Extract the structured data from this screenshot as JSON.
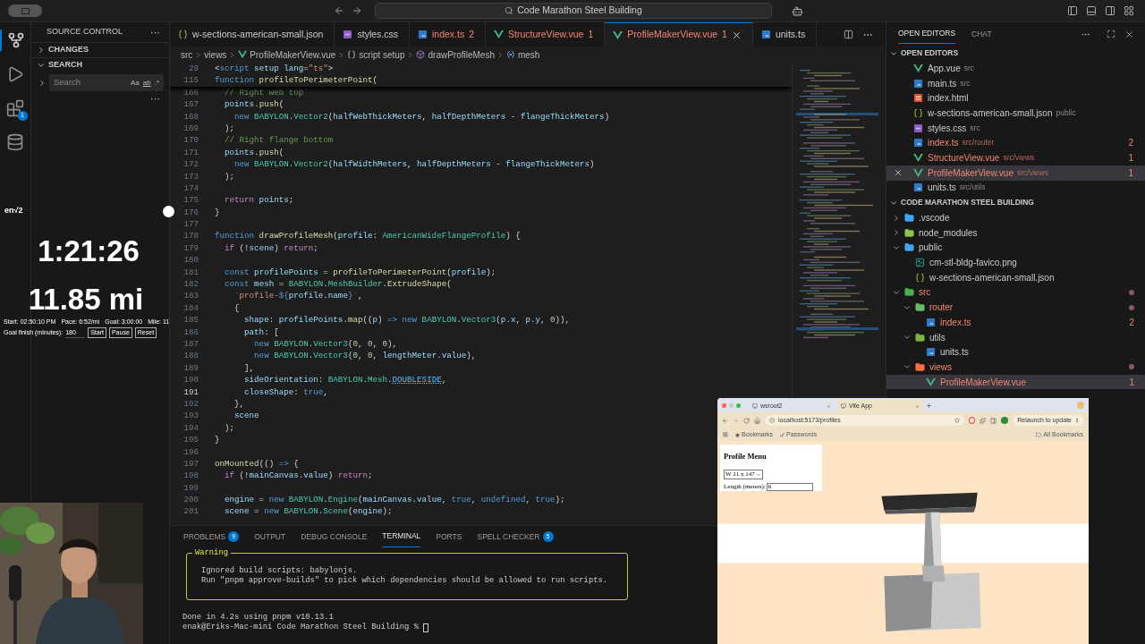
{
  "titlebar": {
    "search": "Code Marathon Steel Building"
  },
  "activity": [
    {
      "kind": "source-control",
      "selected": true
    },
    {
      "kind": "run",
      "selected": false
    },
    {
      "kind": "extensions",
      "selected": false,
      "badge": "1"
    },
    {
      "kind": "database",
      "selected": false
    }
  ],
  "sidebar": {
    "title": "SOURCE CONTROL",
    "more": "···",
    "sections": [
      {
        "label": "CHANGES",
        "expanded": false
      },
      {
        "label": "SEARCH",
        "expanded": true
      }
    ],
    "search": {
      "placeholder": "Search",
      "options": [
        "Aa",
        "ab",
        ".*"
      ]
    },
    "search_more": "···"
  },
  "overlay": {
    "logo": "en√2",
    "time": "1:21:26",
    "distance": "11.85 mi",
    "stats": [
      "Start: 02:50:10 PM",
      "Pace: 6:52/mi",
      "Goal: 3:00:00",
      "Mile: 11"
    ],
    "goal_label": "Goal finish (minutes):",
    "goal_value": "180",
    "buttons": [
      "Start",
      "Pause",
      "Reset"
    ]
  },
  "tabs": [
    {
      "label": "w-sections-american-small.json",
      "kind": "json",
      "selected": false,
      "problem": false
    },
    {
      "label": "styles.css",
      "kind": "css",
      "selected": false,
      "problem": false
    },
    {
      "label": "index.ts",
      "kind": "ts",
      "selected": false,
      "problem": true,
      "badge": "2"
    },
    {
      "label": "StructureView.vue",
      "kind": "vue",
      "selected": false,
      "problem": true,
      "badge": "1"
    },
    {
      "label": "ProfileMakerView.vue",
      "kind": "vue",
      "selected": true,
      "problem": true,
      "badge": "1"
    },
    {
      "label": "units.ts",
      "kind": "ts",
      "selected": false,
      "problem": false
    }
  ],
  "breadcrumbs": [
    {
      "label": "src",
      "kind": "text"
    },
    {
      "label": "views",
      "kind": "text"
    },
    {
      "label": "ProfileMakerView.vue",
      "kind": "vue"
    },
    {
      "label": "script setup",
      "kind": "braces"
    },
    {
      "label": "drawProfileMesh",
      "kind": "method"
    },
    {
      "label": "mesh",
      "kind": "variable"
    }
  ],
  "editor": {
    "sticky": [
      {
        "n": "29",
        "segs": [
          {
            "text": "<",
            "kind": "plain"
          },
          {
            "text": "script",
            "kind": "keyword"
          },
          {
            "text": " setup",
            "kind": "variable"
          },
          {
            "text": " lang",
            "kind": "variable"
          },
          {
            "text": "=",
            "kind": "plain"
          },
          {
            "text": "\"ts\"",
            "kind": "string"
          },
          {
            "text": ">",
            "kind": "plain"
          }
        ]
      },
      {
        "n": "115",
        "segs": [
          {
            "text": "function",
            "kind": "keyword"
          },
          {
            "text": " profileToPerimeterPoint",
            "kind": "function"
          },
          {
            "text": "(",
            "kind": "plain"
          }
        ]
      }
    ],
    "lines": [
      {
        "n": "166",
        "current": false,
        "segs": [
          {
            "text": "  // Right web top",
            "kind": "comment"
          }
        ]
      },
      {
        "n": "167",
        "current": false,
        "segs": [
          {
            "text": "  points",
            "kind": "variable"
          },
          {
            "text": ".",
            "kind": "plain"
          },
          {
            "text": "push",
            "kind": "function"
          },
          {
            "text": "(",
            "kind": "plain"
          }
        ]
      },
      {
        "n": "168",
        "current": false,
        "segs": [
          {
            "text": "    new",
            "kind": "keyword"
          },
          {
            "text": " BABYLON",
            "kind": "type"
          },
          {
            "text": ".",
            "kind": "plain"
          },
          {
            "text": "Vector2",
            "kind": "type"
          },
          {
            "text": "(",
            "kind": "plain"
          },
          {
            "text": "halfWebThickMeters",
            "kind": "variable"
          },
          {
            "text": ", ",
            "kind": "plain"
          },
          {
            "text": "halfDepthMeters",
            "kind": "variable"
          },
          {
            "text": " - ",
            "kind": "plain"
          },
          {
            "text": "flangeThickMeters",
            "kind": "variable"
          },
          {
            "text": ")",
            "kind": "plain"
          }
        ]
      },
      {
        "n": "169",
        "current": false,
        "segs": [
          {
            "text": "  );",
            "kind": "plain"
          }
        ]
      },
      {
        "n": "170",
        "current": false,
        "segs": [
          {
            "text": "  // Right flange bottom",
            "kind": "comment"
          }
        ]
      },
      {
        "n": "171",
        "current": false,
        "segs": [
          {
            "text": "  points",
            "kind": "variable"
          },
          {
            "text": ".",
            "kind": "plain"
          },
          {
            "text": "push",
            "kind": "function"
          },
          {
            "text": "(",
            "kind": "plain"
          }
        ]
      },
      {
        "n": "172",
        "current": false,
        "segs": [
          {
            "text": "    new",
            "kind": "keyword"
          },
          {
            "text": " BABYLON",
            "kind": "type"
          },
          {
            "text": ".",
            "kind": "plain"
          },
          {
            "text": "Vector2",
            "kind": "type"
          },
          {
            "text": "(",
            "kind": "plain"
          },
          {
            "text": "halfWidthMeters",
            "kind": "variable"
          },
          {
            "text": ", ",
            "kind": "plain"
          },
          {
            "text": "halfDepthMeters",
            "kind": "variable"
          },
          {
            "text": " - ",
            "kind": "plain"
          },
          {
            "text": "flangeThickMeters",
            "kind": "variable"
          },
          {
            "text": ")",
            "kind": "plain"
          }
        ]
      },
      {
        "n": "173",
        "current": false,
        "segs": [
          {
            "text": "  );",
            "kind": "plain"
          }
        ]
      },
      {
        "n": "174",
        "current": false
      },
      {
        "n": "175",
        "current": false,
        "segs": [
          {
            "text": "  return",
            "kind": "control"
          },
          {
            "text": " points",
            "kind": "variable"
          },
          {
            "text": ";",
            "kind": "plain"
          }
        ]
      },
      {
        "n": "176",
        "current": false,
        "segs": [
          {
            "text": "}",
            "kind": "plain"
          }
        ]
      },
      {
        "n": "177",
        "current": false
      },
      {
        "n": "178",
        "current": false,
        "segs": [
          {
            "text": "function",
            "kind": "keyword"
          },
          {
            "text": " drawProfileMesh",
            "kind": "function"
          },
          {
            "text": "(",
            "kind": "plain"
          },
          {
            "text": "profile",
            "kind": "variable"
          },
          {
            "text": ": ",
            "kind": "plain"
          },
          {
            "text": "AmericanWideFlangeProfile",
            "kind": "type"
          },
          {
            "text": ") {",
            "kind": "plain"
          }
        ]
      },
      {
        "n": "179",
        "current": false,
        "segs": [
          {
            "text": "  if",
            "kind": "control"
          },
          {
            "text": " (!",
            "kind": "plain"
          },
          {
            "text": "scene",
            "kind": "variable"
          },
          {
            "text": ") ",
            "kind": "plain"
          },
          {
            "text": "return",
            "kind": "control"
          },
          {
            "text": ";",
            "kind": "plain"
          }
        ]
      },
      {
        "n": "180",
        "current": false
      },
      {
        "n": "181",
        "current": false,
        "segs": [
          {
            "text": "  const",
            "kind": "keyword"
          },
          {
            "text": " profilePoints",
            "kind": "variable"
          },
          {
            "text": " = ",
            "kind": "plain"
          },
          {
            "text": "profileToPerimeterPoint",
            "kind": "function"
          },
          {
            "text": "(",
            "kind": "plain"
          },
          {
            "text": "profile",
            "kind": "variable"
          },
          {
            "text": ");",
            "kind": "plain"
          }
        ]
      },
      {
        "n": "182",
        "current": false,
        "segs": [
          {
            "text": "  const",
            "kind": "keyword"
          },
          {
            "text": " mesh",
            "kind": "variable"
          },
          {
            "text": " = ",
            "kind": "plain"
          },
          {
            "text": "BABYLON",
            "kind": "type"
          },
          {
            "text": ".",
            "kind": "plain"
          },
          {
            "text": "MeshBuilder",
            "kind": "type"
          },
          {
            "text": ".",
            "kind": "plain"
          },
          {
            "text": "ExtrudeShape",
            "kind": "function"
          },
          {
            "text": "(",
            "kind": "plain"
          }
        ]
      },
      {
        "n": "183",
        "current": false,
        "segs": [
          {
            "text": "    `profile-",
            "kind": "string"
          },
          {
            "text": "${",
            "kind": "keyword"
          },
          {
            "text": "profile",
            "kind": "variable"
          },
          {
            "text": ".",
            "kind": "plain"
          },
          {
            "text": "name",
            "kind": "variable"
          },
          {
            "text": "}",
            "kind": "keyword"
          },
          {
            "text": "`",
            "kind": "string"
          },
          {
            "text": ",",
            "kind": "plain"
          }
        ]
      },
      {
        "n": "184",
        "current": false,
        "segs": [
          {
            "text": "    {",
            "kind": "plain"
          }
        ]
      },
      {
        "n": "185",
        "current": false,
        "segs": [
          {
            "text": "      shape",
            "kind": "variable"
          },
          {
            "text": ": ",
            "kind": "plain"
          },
          {
            "text": "profilePoints",
            "kind": "variable"
          },
          {
            "text": ".",
            "kind": "plain"
          },
          {
            "text": "map",
            "kind": "function"
          },
          {
            "text": "((",
            "kind": "plain"
          },
          {
            "text": "p",
            "kind": "variable"
          },
          {
            "text": ") ",
            "kind": "plain"
          },
          {
            "text": "=>",
            "kind": "keyword"
          },
          {
            "text": " new",
            "kind": "keyword"
          },
          {
            "text": " BABYLON",
            "kind": "type"
          },
          {
            "text": ".",
            "kind": "plain"
          },
          {
            "text": "Vector3",
            "kind": "type"
          },
          {
            "text": "(",
            "kind": "plain"
          },
          {
            "text": "p",
            "kind": "variable"
          },
          {
            "text": ".",
            "kind": "plain"
          },
          {
            "text": "x",
            "kind": "variable"
          },
          {
            "text": ", ",
            "kind": "plain"
          },
          {
            "text": "p",
            "kind": "variable"
          },
          {
            "text": ".",
            "kind": "plain"
          },
          {
            "text": "y",
            "kind": "variable"
          },
          {
            "text": ", ",
            "kind": "plain"
          },
          {
            "text": "0",
            "kind": "number"
          },
          {
            "text": ")),",
            "kind": "plain"
          }
        ]
      },
      {
        "n": "186",
        "current": false,
        "segs": [
          {
            "text": "      path",
            "kind": "variable"
          },
          {
            "text": ": [",
            "kind": "plain"
          }
        ]
      },
      {
        "n": "187",
        "current": false,
        "segs": [
          {
            "text": "        new",
            "kind": "keyword"
          },
          {
            "text": " BABYLON",
            "kind": "type"
          },
          {
            "text": ".",
            "kind": "plain"
          },
          {
            "text": "Vector3",
            "kind": "type"
          },
          {
            "text": "(",
            "kind": "plain"
          },
          {
            "text": "0",
            "kind": "number"
          },
          {
            "text": ", ",
            "kind": "plain"
          },
          {
            "text": "0",
            "kind": "number"
          },
          {
            "text": ", ",
            "kind": "plain"
          },
          {
            "text": "0",
            "kind": "number"
          },
          {
            "text": "),",
            "kind": "plain"
          }
        ]
      },
      {
        "n": "188",
        "current": false,
        "segs": [
          {
            "text": "        new",
            "kind": "keyword"
          },
          {
            "text": " BABYLON",
            "kind": "type"
          },
          {
            "text": ".",
            "kind": "plain"
          },
          {
            "text": "Vector3",
            "kind": "type"
          },
          {
            "text": "(",
            "kind": "plain"
          },
          {
            "text": "0",
            "kind": "number"
          },
          {
            "text": ", ",
            "kind": "plain"
          },
          {
            "text": "0",
            "kind": "number"
          },
          {
            "text": ", ",
            "kind": "plain"
          },
          {
            "text": "lengthMeter",
            "kind": "variable"
          },
          {
            "text": ".",
            "kind": "plain"
          },
          {
            "text": "value",
            "kind": "variable"
          },
          {
            "text": "),",
            "kind": "plain"
          }
        ]
      },
      {
        "n": "189",
        "current": false,
        "segs": [
          {
            "text": "      ],",
            "kind": "plain"
          }
        ]
      },
      {
        "n": "190",
        "current": false,
        "segs": [
          {
            "text": "      sideOrientation",
            "kind": "variable"
          },
          {
            "text": ": ",
            "kind": "plain"
          },
          {
            "text": "BABYLON",
            "kind": "type"
          },
          {
            "text": ".",
            "kind": "plain"
          },
          {
            "text": "Mesh",
            "kind": "type"
          },
          {
            "text": ".",
            "kind": "plain"
          },
          {
            "text": "DOUBLESIDE",
            "kind": "constant"
          },
          {
            "text": ",",
            "kind": "plain"
          }
        ]
      },
      {
        "n": "191",
        "current": true,
        "segs": [
          {
            "text": "      closeShape",
            "kind": "variable"
          },
          {
            "text": ": ",
            "kind": "plain"
          },
          {
            "text": "true",
            "kind": "keyword"
          },
          {
            "text": ",",
            "kind": "plain"
          }
        ]
      },
      {
        "n": "192",
        "current": false,
        "segs": [
          {
            "text": "    },",
            "kind": "plain"
          }
        ]
      },
      {
        "n": "193",
        "current": false,
        "segs": [
          {
            "text": "    scene",
            "kind": "variable"
          }
        ]
      },
      {
        "n": "194",
        "current": false,
        "segs": [
          {
            "text": "  );",
            "kind": "plain"
          }
        ]
      },
      {
        "n": "195",
        "current": false,
        "segs": [
          {
            "text": "}",
            "kind": "plain"
          }
        ]
      },
      {
        "n": "196",
        "current": false
      },
      {
        "n": "197",
        "current": false,
        "segs": [
          {
            "text": "onMounted",
            "kind": "function"
          },
          {
            "text": "(() ",
            "kind": "plain"
          },
          {
            "text": "=>",
            "kind": "keyword"
          },
          {
            "text": " {",
            "kind": "plain"
          }
        ]
      },
      {
        "n": "198",
        "current": false,
        "segs": [
          {
            "text": "  if",
            "kind": "control"
          },
          {
            "text": " (!",
            "kind": "plain"
          },
          {
            "text": "mainCanvas",
            "kind": "variable"
          },
          {
            "text": ".",
            "kind": "plain"
          },
          {
            "text": "value",
            "kind": "variable"
          },
          {
            "text": ") ",
            "kind": "plain"
          },
          {
            "text": "return",
            "kind": "control"
          },
          {
            "text": ";",
            "kind": "plain"
          }
        ]
      },
      {
        "n": "199",
        "current": false
      },
      {
        "n": "200",
        "current": false,
        "segs": [
          {
            "text": "  engine",
            "kind": "variable"
          },
          {
            "text": " = ",
            "kind": "plain"
          },
          {
            "text": "new",
            "kind": "keyword"
          },
          {
            "text": " BABYLON",
            "kind": "type"
          },
          {
            "text": ".",
            "kind": "plain"
          },
          {
            "text": "Engine",
            "kind": "type"
          },
          {
            "text": "(",
            "kind": "plain"
          },
          {
            "text": "mainCanvas",
            "kind": "variable"
          },
          {
            "text": ".",
            "kind": "plain"
          },
          {
            "text": "value",
            "kind": "variable"
          },
          {
            "text": ", ",
            "kind": "plain"
          },
          {
            "text": "true",
            "kind": "keyword"
          },
          {
            "text": ", ",
            "kind": "plain"
          },
          {
            "text": "undefined",
            "kind": "keyword"
          },
          {
            "text": ", ",
            "kind": "plain"
          },
          {
            "text": "true",
            "kind": "keyword"
          },
          {
            "text": ");",
            "kind": "plain"
          }
        ]
      },
      {
        "n": "201",
        "current": false,
        "segs": [
          {
            "text": "  scene",
            "kind": "variable"
          },
          {
            "text": " = ",
            "kind": "plain"
          },
          {
            "text": "new",
            "kind": "keyword"
          },
          {
            "text": " BABYLON",
            "kind": "type"
          },
          {
            "text": ".",
            "kind": "plain"
          },
          {
            "text": "Scene",
            "kind": "type"
          },
          {
            "text": "(",
            "kind": "plain"
          },
          {
            "text": "engine",
            "kind": "variable"
          },
          {
            "text": ");",
            "kind": "plain"
          }
        ]
      }
    ]
  },
  "panel": {
    "tabs": [
      {
        "label": "PROBLEMS",
        "selected": false,
        "badge": "9"
      },
      {
        "label": "OUTPUT",
        "selected": false
      },
      {
        "label": "DEBUG CONSOLE",
        "selected": false
      },
      {
        "label": "TERMINAL",
        "selected": true
      },
      {
        "label": "PORTS",
        "selected": false
      },
      {
        "label": "SPELL CHECKER",
        "selected": false,
        "badge": "5"
      }
    ],
    "warning": {
      "title": "Warning",
      "lines": [
        "Ignored build scripts: babylonjs.",
        "Run \"pnpm approve-builds\" to pick which dependencies should be allowed to run scripts."
      ]
    },
    "output": "Done in 4.2s using pnpm v10.13.1",
    "prompt": "enak@Eriks-Mac-mini Code Marathon Steel Building %"
  },
  "right": {
    "tabs": [
      {
        "label": "OPEN EDITORS",
        "selected": true
      },
      {
        "label": "CHAT",
        "selected": false
      }
    ],
    "open_editors": {
      "title": "OPEN EDITORS",
      "expanded": true,
      "items": [
        {
          "name": "App.vue",
          "path": "src",
          "kind": "vue",
          "selected": false,
          "problem": false
        },
        {
          "name": "main.ts",
          "path": "src",
          "kind": "ts",
          "selected": false,
          "problem": false
        },
        {
          "name": "index.html",
          "kind": "html",
          "selected": false,
          "problem": false
        },
        {
          "name": "w-sections-american-small.json",
          "path": "public",
          "kind": "json",
          "selected": false,
          "problem": false
        },
        {
          "name": "styles.css",
          "path": "src",
          "kind": "css",
          "selected": false,
          "problem": false
        },
        {
          "name": "index.ts",
          "path": "src/router",
          "kind": "ts",
          "selected": false,
          "problem": true,
          "badge": "2"
        },
        {
          "name": "StructureView.vue",
          "path": "src/views",
          "kind": "vue",
          "selected": false,
          "problem": true,
          "badge": "1"
        },
        {
          "name": "ProfileMakerView.vue",
          "path": "src/views",
          "kind": "vue",
          "selected": true,
          "problem": true,
          "badge": "1"
        },
        {
          "name": "units.ts",
          "path": "src/utils",
          "kind": "ts",
          "selected": false,
          "problem": false
        }
      ]
    },
    "folder": {
      "title": "CODE MARATHON STEEL BUILDING",
      "expanded": true,
      "tree": [
        {
          "name": ".vscode",
          "kind": "folder",
          "color": "#42a5f5",
          "expanded": false,
          "selected": false,
          "problem": false,
          "modified": false
        },
        {
          "name": "node_modules",
          "kind": "folder",
          "color": "#8bc34a",
          "expanded": false,
          "selected": false,
          "problem": false,
          "modified": false
        },
        {
          "name": "public",
          "kind": "folder",
          "color": "#42a5f5",
          "expanded": true,
          "selected": false,
          "problem": false,
          "modified": false,
          "children": [
            {
              "name": "cm-stl-bldg-favico.png",
              "kind": "png",
              "selected": false,
              "problem": false,
              "modified": false
            },
            {
              "name": "w-sections-american-small.json",
              "kind": "json",
              "selected": false,
              "problem": false,
              "modified": false
            }
          ]
        },
        {
          "name": "src",
          "kind": "folder",
          "color": "#4caf50",
          "expanded": true,
          "selected": false,
          "problem": true,
          "modified": true,
          "children": [
            {
              "name": "router",
              "kind": "folder",
              "color": "#66bb6a",
              "expanded": true,
              "selected": false,
              "problem": true,
              "modified": true,
              "children": [
                {
                  "name": "index.ts",
                  "kind": "ts",
                  "selected": false,
                  "problem": true,
                  "modified": false,
                  "badge": "2"
                }
              ]
            },
            {
              "name": "utils",
              "kind": "folder",
              "color": "#7cb342",
              "expanded": true,
              "selected": false,
              "problem": false,
              "modified": false,
              "children": [
                {
                  "name": "units.ts",
                  "kind": "ts",
                  "selected": false,
                  "problem": false,
                  "modified": false
                }
              ]
            },
            {
              "name": "views",
              "kind": "folder",
              "color": "#ff7043",
              "expanded": true,
              "selected": false,
              "problem": true,
              "modified": true,
              "children": [
                {
                  "name": "ProfileMakerView.vue",
                  "kind": "vue",
                  "selected": true,
                  "problem": true,
                  "modified": false,
                  "badge": "1"
                }
              ]
            }
          ]
        }
      ]
    }
  },
  "browser": {
    "tabs": [
      {
        "label": "wsroot2",
        "selected": false
      },
      {
        "label": "Vite App",
        "selected": true
      }
    ],
    "url": "localhost:5173/profiles",
    "relaunch": "Relaunch to update",
    "bookmarks": [
      "Bookmarks",
      "Passwords"
    ],
    "all_bookmarks": "All Bookmarks",
    "page": {
      "title": "Profile Menu",
      "select": "W 21 x 147",
      "length_label": "Length (meters):",
      "length_value": "6"
    }
  }
}
